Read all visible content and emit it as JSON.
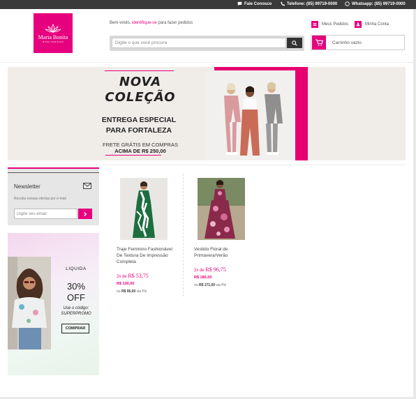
{
  "topbar": {
    "contact": "Fale Conosco",
    "phone": "Telefone: (85) 99719-0000",
    "whatsapp": "Whatsapp: (85) 99719-0000"
  },
  "logo": {
    "name": "Maria Bonita",
    "tagline": "MODA FEMININA"
  },
  "header": {
    "welcome_prefix": "Bem-vindo,",
    "welcome_link": "identifique-se",
    "welcome_suffix": "para fazer pedidos",
    "search_placeholder": "Digite o que você procura",
    "orders_label": "Meus Pedidos",
    "account_label": "Minha Conta",
    "cart_label": "Carrinho vazio"
  },
  "banner": {
    "title_line1": "NOVA",
    "title_line2": "COLEÇÃO",
    "subtitle_line1": "ENTREGA ESPECIAL",
    "subtitle_line2": "PARA FORTALEZA",
    "shipping": "FRETE GRÁTIS EM COMPRAS",
    "shipping_min": "ACIMA DE R$ 250,00"
  },
  "newsletter": {
    "title": "Newsletter",
    "description": "Receba nossas ofertas por e-mail",
    "placeholder": "Digite seu email"
  },
  "promo": {
    "label": "LIQUIDA",
    "discount_line1": "30%",
    "discount_line2": "OFF",
    "code_line1": "Use o código:",
    "code_line2": "SUPERPROMO",
    "button": "COMPRAR"
  },
  "products": [
    {
      "name": "Traje Feminino Fashionável De Textura De Impressão Completa",
      "installments_prefix": "2x de",
      "installment_value": "R$ 53,75",
      "price": "R$ 100,00",
      "pix_prefix": "ou",
      "pix_price": "R$ 95,00",
      "pix_suffix": "via Pix"
    },
    {
      "name": "Vestido Floral de Primavera/Verão",
      "installments_prefix": "2x de",
      "installment_value": "R$ 96,75",
      "price": "R$ 180,00",
      "pix_prefix": "ou",
      "pix_price": "R$ 171,00",
      "pix_suffix": "via Pix"
    }
  ],
  "colors": {
    "brand_pink": "#e6007e",
    "topbar": "#3a3a3a",
    "banner_bg": "#f0ede9"
  },
  "icons": [
    "chat-icon",
    "phone-icon",
    "whatsapp-icon",
    "orders-icon",
    "account-icon",
    "search-icon",
    "cart-icon",
    "mail-icon",
    "arrow-right-icon"
  ]
}
